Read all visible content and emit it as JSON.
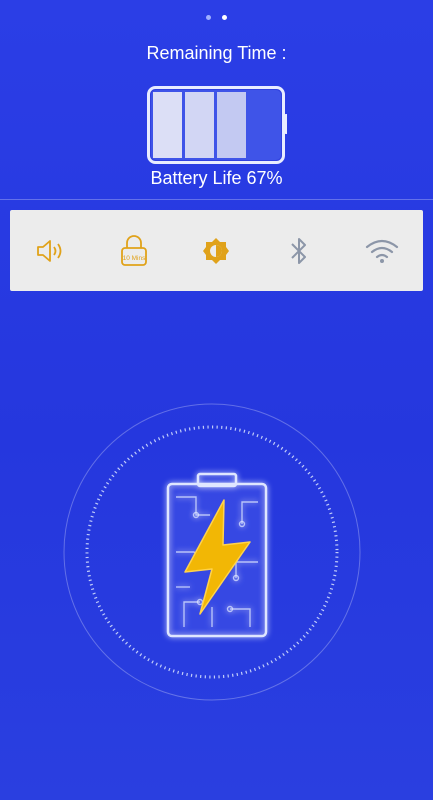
{
  "pager": {
    "pages": 2,
    "active_index": 1
  },
  "header": {
    "title": "Remaining Time :"
  },
  "battery": {
    "percent": 67,
    "label": "Battery Life 67%"
  },
  "toolbar": {
    "items": [
      {
        "name": "sound",
        "icon": "speaker-icon"
      },
      {
        "name": "screen-timeout",
        "icon": "lock-icon",
        "label": "10 Mins"
      },
      {
        "name": "brightness",
        "icon": "brightness-icon"
      },
      {
        "name": "bluetooth",
        "icon": "bluetooth-icon"
      },
      {
        "name": "wifi",
        "icon": "wifi-icon"
      }
    ]
  },
  "colors": {
    "background": "#2b3ee6",
    "accent": "#e0a21a",
    "icon_gray": "#8c96a8",
    "toolbar_bg": "#ececec"
  }
}
